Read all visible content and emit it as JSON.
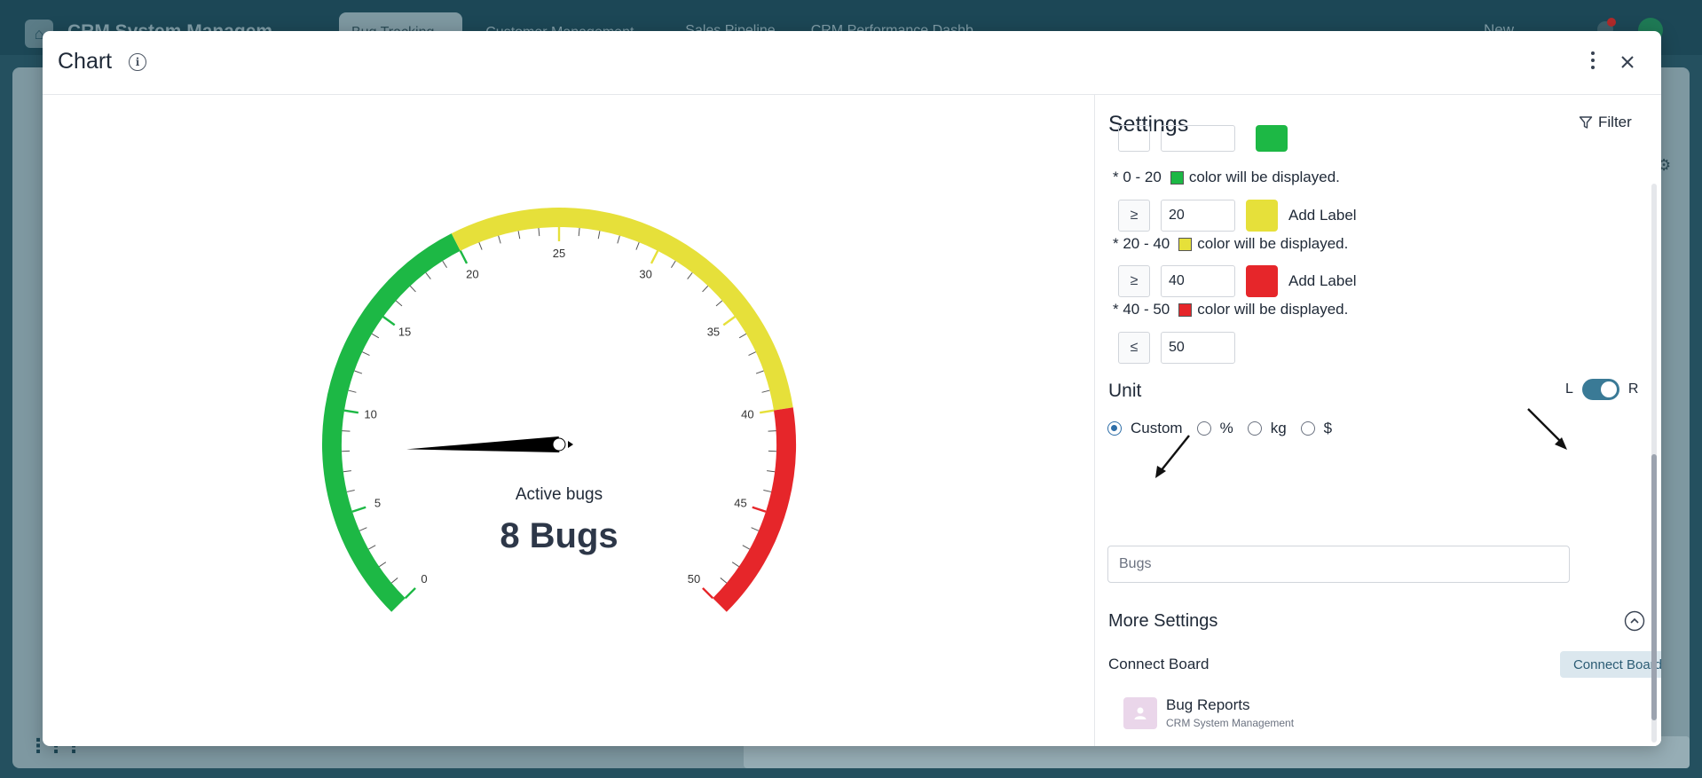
{
  "background": {
    "app_name": "CRM System Managem",
    "tabs": [
      {
        "label": "Bug Tracking ⌄",
        "active": true
      },
      {
        "label": "Customer Management ⌄",
        "active": false
      },
      {
        "label": "Sales Pipeline",
        "active": false
      },
      {
        "label": "CRM Performance Dashb",
        "active": false
      }
    ],
    "new_label": "New"
  },
  "modal": {
    "title": "Chart",
    "info_icon": "info-icon",
    "menu_icon": "kebab-icon",
    "close_icon": "close-icon"
  },
  "chart_data": {
    "type": "gauge",
    "title": "Active bugs",
    "value": 8,
    "value_label": "8 Bugs",
    "unit": "Bugs",
    "min": 0,
    "max": 50,
    "major_ticks": [
      0,
      5,
      10,
      15,
      20,
      25,
      30,
      35,
      40,
      45,
      50
    ],
    "bands": [
      {
        "from": 0,
        "to": 20,
        "color": "#1db845"
      },
      {
        "from": 20,
        "to": 40,
        "color": "#e6e03a"
      },
      {
        "from": 40,
        "to": 50,
        "color": "#e6262a"
      }
    ]
  },
  "settings": {
    "title": "Settings",
    "filter_label": "Filter",
    "ranges": [
      {
        "text": "* 0 - 20",
        "suffix": "color will be displayed.",
        "color": "#1db845"
      },
      {
        "text": "* 20 - 40",
        "suffix": "color will be displayed.",
        "color": "#e6e03a"
      },
      {
        "text": "* 40 - 50",
        "suffix": "color will be displayed.",
        "color": "#e6262a"
      }
    ],
    "thresholds": [
      {
        "op": "≥",
        "value": "20",
        "color": "#e6e03a",
        "label": "Add Label"
      },
      {
        "op": "≥",
        "value": "40",
        "color": "#e6262a",
        "label": "Add Label"
      }
    ],
    "max_row": {
      "op": "≤",
      "value": "50"
    },
    "unit": {
      "title": "Unit",
      "toggle_left": "L",
      "toggle_right": "R",
      "toggle_on": true,
      "options": [
        {
          "label": "Custom",
          "checked": true
        },
        {
          "label": "%",
          "checked": false
        },
        {
          "label": "kg",
          "checked": false
        },
        {
          "label": "$",
          "checked": false
        }
      ],
      "custom_value": "Bugs"
    },
    "more_settings": "More Settings",
    "connect_board_title": "Connect Board",
    "connect_board_button": "Connect Board",
    "board": {
      "name": "Bug Reports",
      "subtitle": "CRM System Management"
    }
  }
}
